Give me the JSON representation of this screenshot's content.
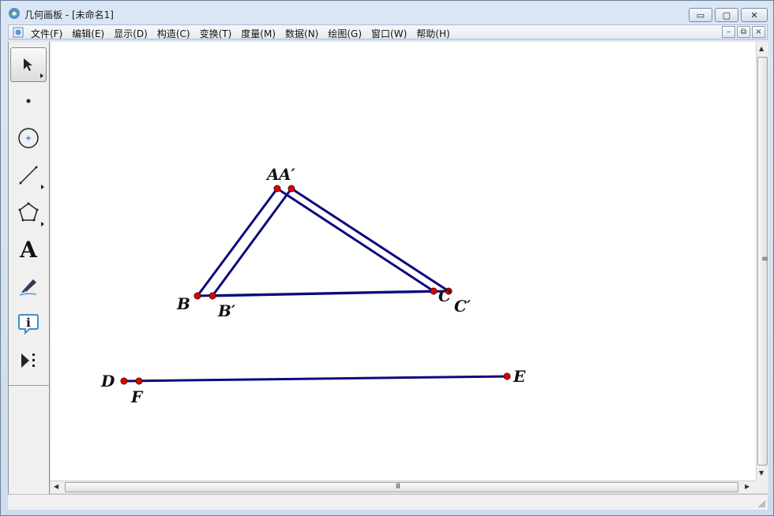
{
  "window": {
    "title": "几何画板 - [未命名1]",
    "buttons": {
      "minimize": "▭",
      "maximize": "▢",
      "close": "✕"
    }
  },
  "menubar": {
    "items": [
      "文件(F)",
      "编辑(E)",
      "显示(D)",
      "构造(C)",
      "变换(T)",
      "度量(M)",
      "数据(N)",
      "绘图(G)",
      "窗口(W)",
      "帮助(H)"
    ],
    "mdi_buttons": {
      "minimize": "–",
      "restore": "⧉",
      "close": "×"
    }
  },
  "toolbox": {
    "tools": [
      {
        "name": "arrow-tool-icon",
        "selected": true,
        "has_submenu": true
      },
      {
        "name": "point-tool-icon",
        "selected": false,
        "has_submenu": false
      },
      {
        "name": "compass-tool-icon",
        "selected": false,
        "has_submenu": false
      },
      {
        "name": "line-tool-icon",
        "selected": false,
        "has_submenu": true
      },
      {
        "name": "polygon-tool-icon",
        "selected": false,
        "has_submenu": true
      },
      {
        "name": "text-tool-icon",
        "selected": false,
        "has_submenu": false,
        "glyph": "A"
      },
      {
        "name": "marker-tool-icon",
        "selected": false,
        "has_submenu": false
      },
      {
        "name": "info-tool-icon",
        "selected": false,
        "has_submenu": false,
        "glyph": "i"
      },
      {
        "name": "custom-tool-icon",
        "selected": false,
        "has_submenu": false
      }
    ]
  },
  "sketch": {
    "line_color": "#0b0b7a",
    "point_color": "#e00000",
    "labels": {
      "A": "A",
      "A_prime": "A′",
      "B": "B",
      "B_prime": "B′",
      "C": "C",
      "C_prime": "C′",
      "D": "D",
      "E": "E",
      "F": "F"
    }
  },
  "scrollbars": {
    "grip": "III"
  }
}
